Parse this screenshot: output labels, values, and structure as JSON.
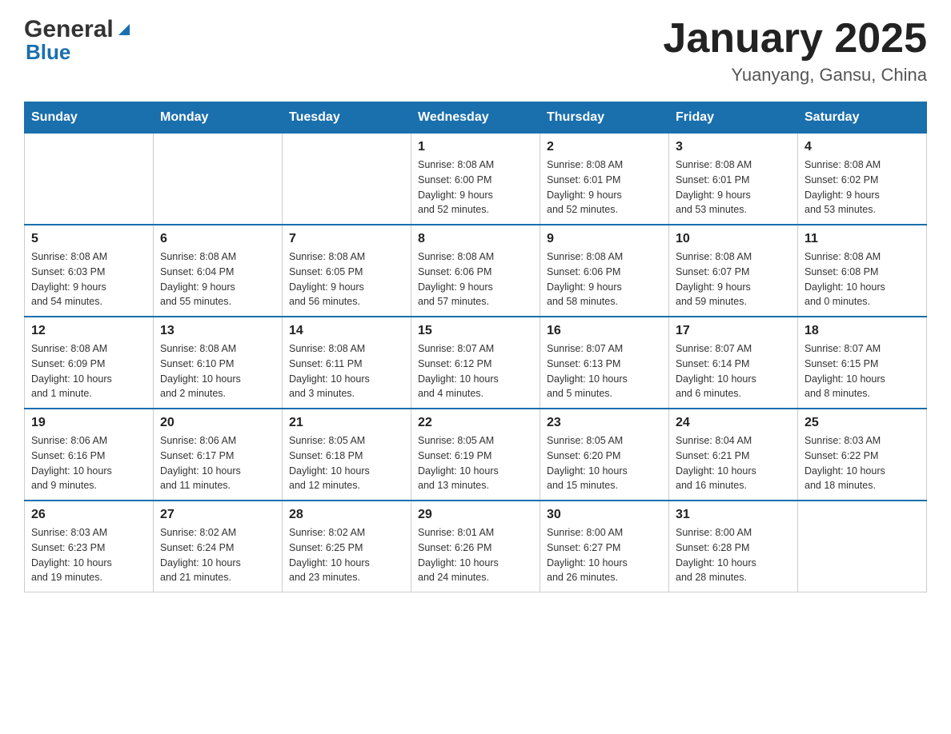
{
  "header": {
    "logo_general": "General",
    "logo_blue": "Blue",
    "month_title": "January 2025",
    "location": "Yuanyang, Gansu, China"
  },
  "days_of_week": [
    "Sunday",
    "Monday",
    "Tuesday",
    "Wednesday",
    "Thursday",
    "Friday",
    "Saturday"
  ],
  "weeks": [
    [
      {
        "day": "",
        "info": ""
      },
      {
        "day": "",
        "info": ""
      },
      {
        "day": "",
        "info": ""
      },
      {
        "day": "1",
        "info": "Sunrise: 8:08 AM\nSunset: 6:00 PM\nDaylight: 9 hours\nand 52 minutes."
      },
      {
        "day": "2",
        "info": "Sunrise: 8:08 AM\nSunset: 6:01 PM\nDaylight: 9 hours\nand 52 minutes."
      },
      {
        "day": "3",
        "info": "Sunrise: 8:08 AM\nSunset: 6:01 PM\nDaylight: 9 hours\nand 53 minutes."
      },
      {
        "day": "4",
        "info": "Sunrise: 8:08 AM\nSunset: 6:02 PM\nDaylight: 9 hours\nand 53 minutes."
      }
    ],
    [
      {
        "day": "5",
        "info": "Sunrise: 8:08 AM\nSunset: 6:03 PM\nDaylight: 9 hours\nand 54 minutes."
      },
      {
        "day": "6",
        "info": "Sunrise: 8:08 AM\nSunset: 6:04 PM\nDaylight: 9 hours\nand 55 minutes."
      },
      {
        "day": "7",
        "info": "Sunrise: 8:08 AM\nSunset: 6:05 PM\nDaylight: 9 hours\nand 56 minutes."
      },
      {
        "day": "8",
        "info": "Sunrise: 8:08 AM\nSunset: 6:06 PM\nDaylight: 9 hours\nand 57 minutes."
      },
      {
        "day": "9",
        "info": "Sunrise: 8:08 AM\nSunset: 6:06 PM\nDaylight: 9 hours\nand 58 minutes."
      },
      {
        "day": "10",
        "info": "Sunrise: 8:08 AM\nSunset: 6:07 PM\nDaylight: 9 hours\nand 59 minutes."
      },
      {
        "day": "11",
        "info": "Sunrise: 8:08 AM\nSunset: 6:08 PM\nDaylight: 10 hours\nand 0 minutes."
      }
    ],
    [
      {
        "day": "12",
        "info": "Sunrise: 8:08 AM\nSunset: 6:09 PM\nDaylight: 10 hours\nand 1 minute."
      },
      {
        "day": "13",
        "info": "Sunrise: 8:08 AM\nSunset: 6:10 PM\nDaylight: 10 hours\nand 2 minutes."
      },
      {
        "day": "14",
        "info": "Sunrise: 8:08 AM\nSunset: 6:11 PM\nDaylight: 10 hours\nand 3 minutes."
      },
      {
        "day": "15",
        "info": "Sunrise: 8:07 AM\nSunset: 6:12 PM\nDaylight: 10 hours\nand 4 minutes."
      },
      {
        "day": "16",
        "info": "Sunrise: 8:07 AM\nSunset: 6:13 PM\nDaylight: 10 hours\nand 5 minutes."
      },
      {
        "day": "17",
        "info": "Sunrise: 8:07 AM\nSunset: 6:14 PM\nDaylight: 10 hours\nand 6 minutes."
      },
      {
        "day": "18",
        "info": "Sunrise: 8:07 AM\nSunset: 6:15 PM\nDaylight: 10 hours\nand 8 minutes."
      }
    ],
    [
      {
        "day": "19",
        "info": "Sunrise: 8:06 AM\nSunset: 6:16 PM\nDaylight: 10 hours\nand 9 minutes."
      },
      {
        "day": "20",
        "info": "Sunrise: 8:06 AM\nSunset: 6:17 PM\nDaylight: 10 hours\nand 11 minutes."
      },
      {
        "day": "21",
        "info": "Sunrise: 8:05 AM\nSunset: 6:18 PM\nDaylight: 10 hours\nand 12 minutes."
      },
      {
        "day": "22",
        "info": "Sunrise: 8:05 AM\nSunset: 6:19 PM\nDaylight: 10 hours\nand 13 minutes."
      },
      {
        "day": "23",
        "info": "Sunrise: 8:05 AM\nSunset: 6:20 PM\nDaylight: 10 hours\nand 15 minutes."
      },
      {
        "day": "24",
        "info": "Sunrise: 8:04 AM\nSunset: 6:21 PM\nDaylight: 10 hours\nand 16 minutes."
      },
      {
        "day": "25",
        "info": "Sunrise: 8:03 AM\nSunset: 6:22 PM\nDaylight: 10 hours\nand 18 minutes."
      }
    ],
    [
      {
        "day": "26",
        "info": "Sunrise: 8:03 AM\nSunset: 6:23 PM\nDaylight: 10 hours\nand 19 minutes."
      },
      {
        "day": "27",
        "info": "Sunrise: 8:02 AM\nSunset: 6:24 PM\nDaylight: 10 hours\nand 21 minutes."
      },
      {
        "day": "28",
        "info": "Sunrise: 8:02 AM\nSunset: 6:25 PM\nDaylight: 10 hours\nand 23 minutes."
      },
      {
        "day": "29",
        "info": "Sunrise: 8:01 AM\nSunset: 6:26 PM\nDaylight: 10 hours\nand 24 minutes."
      },
      {
        "day": "30",
        "info": "Sunrise: 8:00 AM\nSunset: 6:27 PM\nDaylight: 10 hours\nand 26 minutes."
      },
      {
        "day": "31",
        "info": "Sunrise: 8:00 AM\nSunset: 6:28 PM\nDaylight: 10 hours\nand 28 minutes."
      },
      {
        "day": "",
        "info": ""
      }
    ]
  ]
}
